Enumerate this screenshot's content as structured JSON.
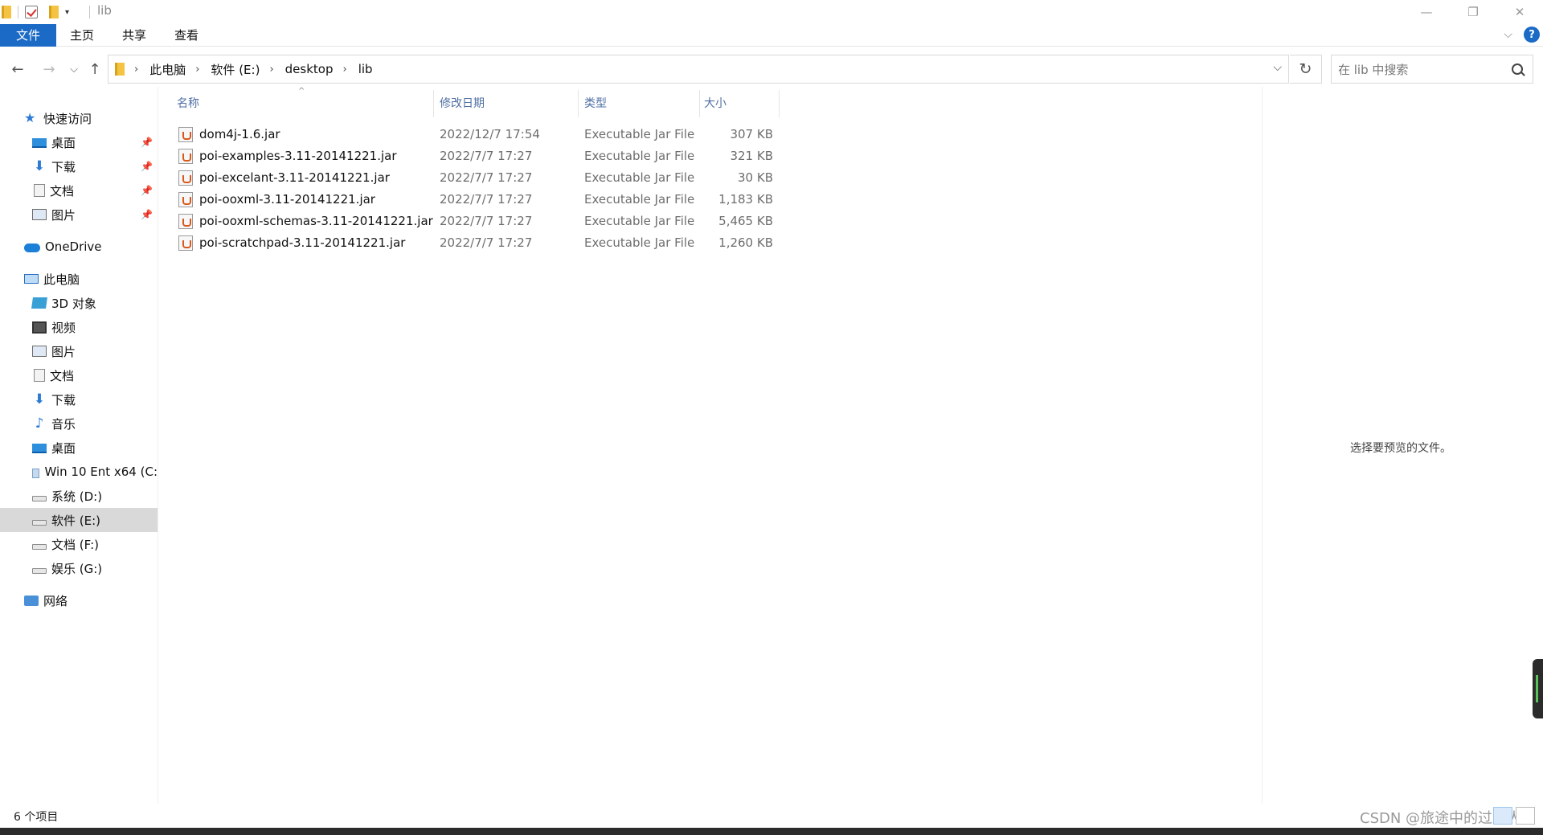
{
  "window": {
    "title": "lib",
    "minimize": "—",
    "restore": "❐",
    "close": "✕"
  },
  "ribbon": {
    "tabs": [
      "文件",
      "主页",
      "共享",
      "查看"
    ],
    "expand": "⌵",
    "help": "?"
  },
  "nav": {
    "back": "←",
    "forward": "→",
    "recent": "⌵",
    "up": "↑",
    "breadcrumbs": [
      "此电脑",
      "软件 (E:)",
      "desktop",
      "lib"
    ],
    "breadcrumb_sep": "›",
    "dropdown": "⌵",
    "refresh": "↻",
    "search_placeholder": "在 lib 中搜索"
  },
  "sidebar": {
    "quick_access": {
      "label": "快速访问",
      "icon": "star-icon"
    },
    "pinned": [
      {
        "label": "桌面",
        "icon": "desktop-icon"
      },
      {
        "label": "下载",
        "icon": "download-icon"
      },
      {
        "label": "文档",
        "icon": "document-icon"
      },
      {
        "label": "图片",
        "icon": "pictures-icon"
      }
    ],
    "pin_glyph": "📌",
    "onedrive": {
      "label": "OneDrive",
      "icon": "cloud-icon"
    },
    "this_pc": {
      "label": "此电脑",
      "icon": "computer-icon"
    },
    "pc_items": [
      {
        "label": "3D 对象",
        "icon": "3d-objects-icon"
      },
      {
        "label": "视频",
        "icon": "video-icon"
      },
      {
        "label": "图片",
        "icon": "pictures-icon"
      },
      {
        "label": "文档",
        "icon": "document-icon"
      },
      {
        "label": "下载",
        "icon": "download-icon"
      },
      {
        "label": "音乐",
        "icon": "music-icon"
      },
      {
        "label": "桌面",
        "icon": "desktop-icon"
      },
      {
        "label": "Win 10 Ent x64 (C:",
        "icon": "windows-drive-icon"
      },
      {
        "label": "系统 (D:)",
        "icon": "drive-icon"
      },
      {
        "label": "软件 (E:)",
        "icon": "drive-icon",
        "selected": true
      },
      {
        "label": "文档 (F:)",
        "icon": "drive-icon"
      },
      {
        "label": "娱乐 (G:)",
        "icon": "drive-icon"
      }
    ],
    "network": {
      "label": "网络",
      "icon": "network-icon"
    }
  },
  "columns": {
    "name": "名称",
    "date": "修改日期",
    "type": "类型",
    "size": "大小",
    "sort_indicator": "^"
  },
  "files": [
    {
      "name": "dom4j-1.6.jar",
      "date": "2022/12/7 17:54",
      "type": "Executable Jar File",
      "size": "307 KB"
    },
    {
      "name": "poi-examples-3.11-20141221.jar",
      "date": "2022/7/7 17:27",
      "type": "Executable Jar File",
      "size": "321 KB"
    },
    {
      "name": "poi-excelant-3.11-20141221.jar",
      "date": "2022/7/7 17:27",
      "type": "Executable Jar File",
      "size": "30 KB"
    },
    {
      "name": "poi-ooxml-3.11-20141221.jar",
      "date": "2022/7/7 17:27",
      "type": "Executable Jar File",
      "size": "1,183 KB"
    },
    {
      "name": "poi-ooxml-schemas-3.11-20141221.jar",
      "date": "2022/7/7 17:27",
      "type": "Executable Jar File",
      "size": "5,465 KB"
    },
    {
      "name": "poi-scratchpad-3.11-20141221.jar",
      "date": "2022/7/7 17:27",
      "type": "Executable Jar File",
      "size": "1,260 KB"
    }
  ],
  "preview": {
    "message": "选择要预览的文件。"
  },
  "status": {
    "item_count": "6 个项目",
    "watermark": "CSDN @旅途中的过路人"
  }
}
